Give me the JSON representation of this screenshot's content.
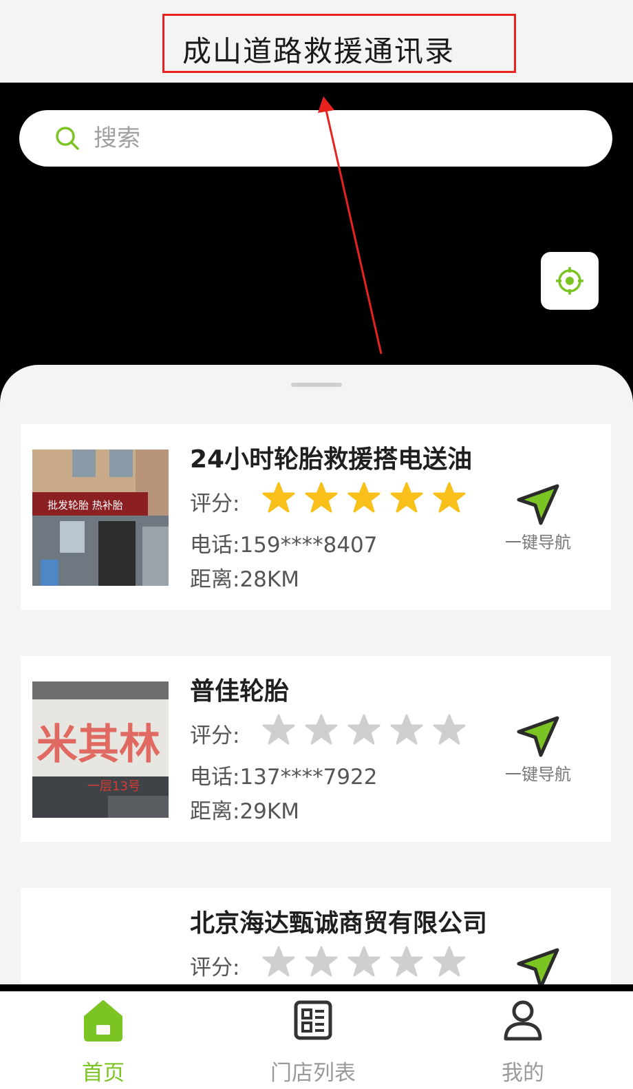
{
  "header": {
    "title": "成山道路救援通讯录"
  },
  "search": {
    "placeholder": "搜索"
  },
  "colors": {
    "accent": "#7bc424",
    "star_on": "#f9bf1a",
    "star_off": "#cfcfcf",
    "annotation": "#e8231f"
  },
  "stores": [
    {
      "name": "24小时轮胎救援搭电送油",
      "rating_label": "评分:",
      "rating": 5,
      "max_rating": 5,
      "phone": "电话:159****8407",
      "distance": "距离:28KM",
      "nav_label": "一键导航",
      "sign_text": "批发轮胎 热补胎"
    },
    {
      "name": "普佳轮胎",
      "rating_label": "评分:",
      "rating": 0,
      "max_rating": 5,
      "phone": "电话:137****7922",
      "distance": "距离:29KM",
      "nav_label": "一键导航",
      "sign_text": "米其林",
      "sign_sub": "一层13号"
    },
    {
      "name": "北京海达甄诚商贸有限公司",
      "rating_label": "评分:",
      "rating": 0,
      "max_rating": 5
    }
  ],
  "tabs": [
    {
      "label": "首页",
      "icon": "home-icon",
      "active": true
    },
    {
      "label": "门店列表",
      "icon": "list-icon",
      "active": false
    },
    {
      "label": "我的",
      "icon": "user-icon",
      "active": false
    }
  ]
}
